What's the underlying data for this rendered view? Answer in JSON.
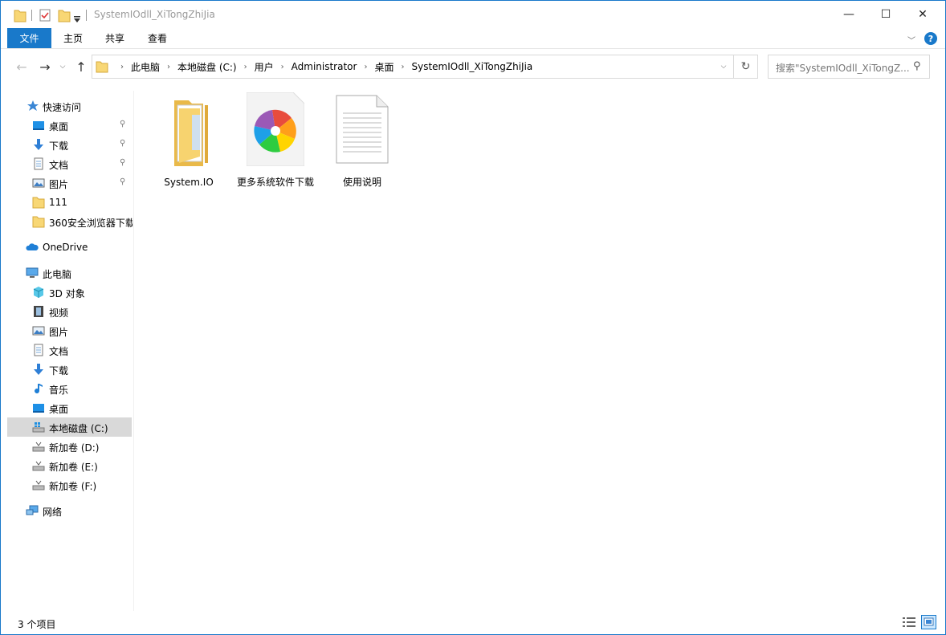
{
  "window": {
    "title": "SystemIOdll_XiTongZhiJia",
    "controls": {
      "minimize": "—",
      "maximize": "☐",
      "close": "✕"
    }
  },
  "ribbon": {
    "tabs": [
      "文件",
      "主页",
      "共享",
      "查看"
    ],
    "collapse_glyph": "﹀",
    "help_glyph": "?"
  },
  "navigation": {
    "back_glyph": "←",
    "forward_glyph": "→",
    "recent_glyph": "⌵",
    "up_glyph": "↑",
    "breadcrumbs": [
      "此电脑",
      "本地磁盘 (C:)",
      "用户",
      "Administrator",
      "桌面",
      "SystemIOdll_XiTongZhiJia"
    ],
    "breadcrumb_sep": "›",
    "dropdown_glyph": "⌵",
    "refresh_glyph": "↻",
    "search_placeholder": "搜索\"SystemIOdll_XiTongZ...",
    "search_glyph": "⚲"
  },
  "sidebar": {
    "quick_access": "快速访问",
    "quick_items": [
      "桌面",
      "下载",
      "文档",
      "图片",
      "111",
      "360安全浏览器下载"
    ],
    "onedrive": "OneDrive",
    "this_pc": "此电脑",
    "pc_items": [
      "3D 对象",
      "视频",
      "图片",
      "文档",
      "下载",
      "音乐",
      "桌面",
      "本地磁盘 (C:)",
      "新加卷 (D:)",
      "新加卷 (E:)",
      "新加卷 (F:)"
    ],
    "network": "网络",
    "pin_glyph": "📌",
    "selected": "本地磁盘 (C:)"
  },
  "files": [
    {
      "name": "System.IO",
      "icon": "folder-icon"
    },
    {
      "name": "更多系统软件下载",
      "icon": "app-shortcut-icon"
    },
    {
      "name": "使用说明",
      "icon": "text-document-icon"
    }
  ],
  "status": {
    "item_count": "3 个项目"
  },
  "colors": {
    "accent": "#1979ca",
    "folder": "#f8d775",
    "selected": "#d9d9d9"
  }
}
